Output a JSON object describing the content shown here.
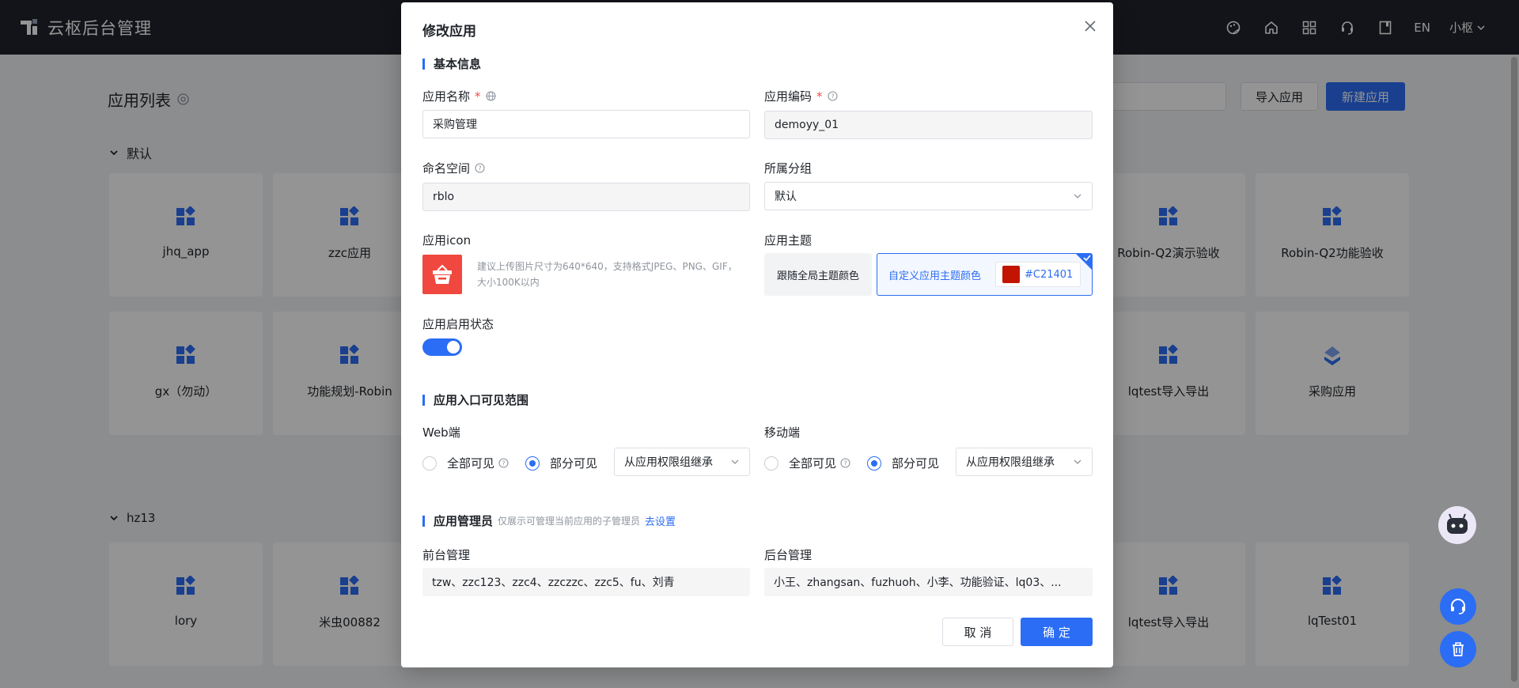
{
  "header": {
    "brand": "云枢后台管理",
    "lang": "EN",
    "user": "小枢",
    "icons": [
      "palette-icon",
      "home-icon",
      "grid-icon",
      "headset-icon",
      "book-icon"
    ]
  },
  "page": {
    "title": "应用列表",
    "import_label": "导入应用",
    "new_label": "新建应用",
    "groups": [
      {
        "name": "默认",
        "row1": [
          "jhq_app",
          "zzc应用",
          "Robin-Q2演示验收",
          "Robin-Q2功能验收"
        ],
        "row2": [
          "gx（勿动）",
          "功能规划-Robin",
          "lqtest导入导出",
          "采购应用"
        ]
      },
      {
        "name": "hz13",
        "row1": [
          "lory",
          "米虫00882",
          "lqtest导入导出",
          "lqTest01"
        ]
      }
    ]
  },
  "modal": {
    "title": "修改应用",
    "sections": {
      "basic": "基本信息",
      "visibility": "应用入口可见范围",
      "admins": "应用管理员",
      "admins_sub": "仅展示可管理当前应用的子管理员",
      "admins_link": "去设置"
    },
    "fields": {
      "app_name_label": "应用名称",
      "app_name_value": "采购管理",
      "app_code_label": "应用编码",
      "app_code_value": "demoyy_01",
      "namespace_label": "命名空间",
      "namespace_value": "rblo",
      "group_label": "所属分组",
      "group_value": "默认",
      "icon_label": "应用icon",
      "icon_hint": "建议上传图片尺寸为640*640，支持格式JPEG、PNG、GIF，大小100K以内",
      "theme_label": "应用主题",
      "theme_follow": "跟随全局主题颜色",
      "theme_custom": "自定义应用主题颜色",
      "theme_color": "#C21401",
      "status_label": "应用启用状态",
      "status_on": true
    },
    "visibility": {
      "web_label": "Web端",
      "mobile_label": "移动端",
      "all_visible": "全部可见",
      "partial_visible": "部分可见",
      "web_select": "从应用权限组继承",
      "mobile_select": "从应用权限组继承"
    },
    "admins": {
      "front_label": "前台管理",
      "front_value": "tzw、zzc123、zzc4、zzczzc、zzc5、fu、刘青",
      "back_label": "后台管理",
      "back_value": "小王、zhangsan、fuzhuoh、小李、功能验证、lq03、..."
    },
    "cancel_label": "取 消",
    "ok_label": "确 定"
  },
  "colors": {
    "primary": "#2b6df4",
    "header_bg": "#20242d",
    "required": "#f54a45",
    "app_icon_bg": "#f0483e"
  }
}
